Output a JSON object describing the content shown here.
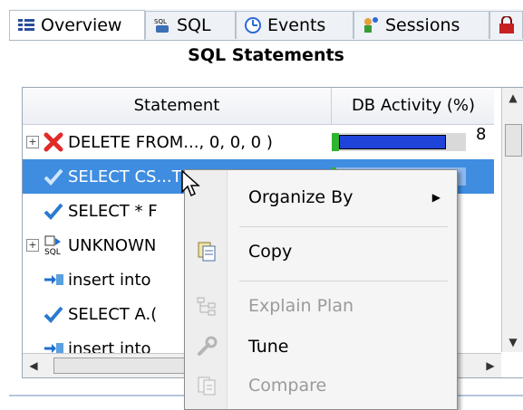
{
  "tabs": [
    {
      "label": "Overview",
      "icon": "overview-icon",
      "active": true
    },
    {
      "label": "SQL",
      "icon": "sql-icon",
      "active": false
    },
    {
      "label": "Events",
      "icon": "events-clock-icon",
      "active": false
    },
    {
      "label": "Sessions",
      "icon": "sessions-icon",
      "active": false
    }
  ],
  "panel": {
    "title": "SQL Statements"
  },
  "table": {
    "columns": [
      "Statement",
      "DB Activity (%)"
    ],
    "rows": [
      {
        "icon": "error-x-icon",
        "expandable": true,
        "text": "DELETE FROM..., 0, 0, 0 )",
        "activity": 85,
        "activity_label": "8"
      },
      {
        "icon": "check-icon",
        "expandable": false,
        "text": "SELECT CS...TOMERID, I",
        "selected": true
      },
      {
        "icon": "check-icon",
        "expandable": false,
        "text": "SELECT * F"
      },
      {
        "icon": "sql-unknown-icon",
        "expandable": true,
        "text": "UNKNOWN"
      },
      {
        "icon": "insert-arrow-icon",
        "expandable": false,
        "text": "insert into"
      },
      {
        "icon": "check-icon",
        "expandable": false,
        "text": "SELECT A.("
      },
      {
        "icon": "insert-arrow-icon",
        "expandable": false,
        "text": "insert into"
      }
    ]
  },
  "context_menu": {
    "items": [
      {
        "label": "Organize By",
        "has_submenu": true,
        "enabled": true,
        "icon": ""
      },
      {
        "label": "Copy",
        "enabled": true,
        "icon": "copy-icon"
      },
      {
        "label": "Explain Plan",
        "enabled": false,
        "icon": "explain-plan-icon"
      },
      {
        "label": "Tune",
        "enabled": true,
        "icon": "tune-wrench-icon"
      },
      {
        "label": "Compare",
        "enabled": false,
        "icon": "compare-icon"
      }
    ]
  },
  "colors": {
    "selection": "#3f8de0",
    "bar_blue": "#1f43d8",
    "bar_green": "#2fb52f"
  }
}
